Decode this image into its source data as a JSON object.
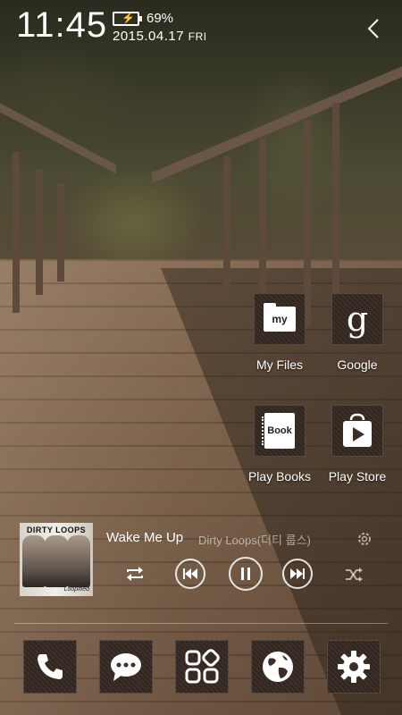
{
  "status_bar": {
    "time": "11:45",
    "battery_percent": "69%",
    "date": "2015.04.17",
    "day": "FRI"
  },
  "apps": [
    {
      "label": "My Files",
      "icon": "my-files-icon",
      "icon_text": "my"
    },
    {
      "label": "Google",
      "icon": "google-icon",
      "icon_text": "g"
    },
    {
      "label": "Play Books",
      "icon": "play-books-icon",
      "icon_text": "Book"
    },
    {
      "label": "Play Store",
      "icon": "play-store-icon"
    }
  ],
  "music": {
    "song_title": "Wake Me Up",
    "artist": "Dirty Loops(더티 룹스)",
    "album_band": "DIRTY LOOPS",
    "album_tag": "Loopified"
  },
  "dock": [
    {
      "icon": "phone-icon"
    },
    {
      "icon": "messages-icon"
    },
    {
      "icon": "apps-icon"
    },
    {
      "icon": "internet-icon"
    },
    {
      "icon": "settings-icon"
    }
  ]
}
